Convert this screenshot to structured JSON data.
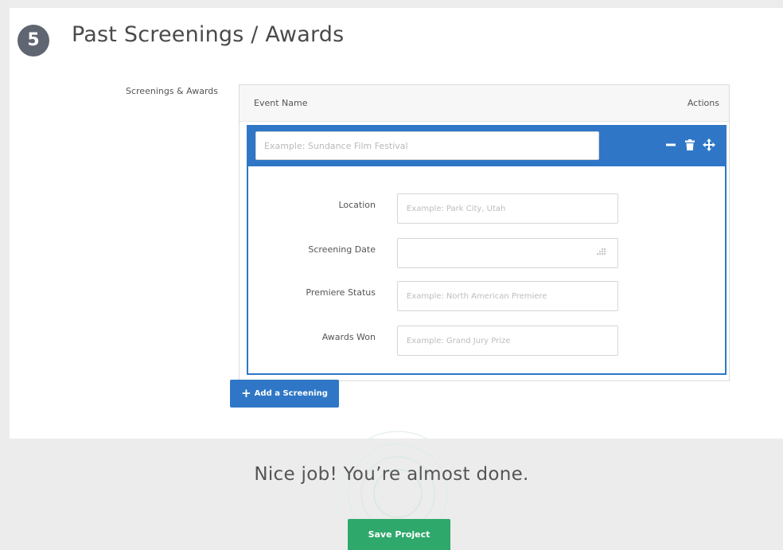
{
  "section": {
    "step_number": "5",
    "title": "Past Screenings / Awards",
    "field_label": "Screenings & Awards"
  },
  "table": {
    "col_event_name": "Event Name",
    "col_actions": "Actions"
  },
  "entry": {
    "event_placeholder": "Example: Sundance Film Festival",
    "actions": [
      "minus-icon",
      "trash-icon",
      "move-icon"
    ],
    "fields": [
      {
        "label": "Location",
        "placeholder": "Example: Park City, Utah",
        "value": ""
      },
      {
        "label": "Screening Date",
        "placeholder": "",
        "value": ""
      },
      {
        "label": "Premiere Status",
        "placeholder": "Example: North American Premiere",
        "value": ""
      },
      {
        "label": "Awards Won",
        "placeholder": "Example: Grand Jury Prize",
        "value": ""
      }
    ]
  },
  "add_button": {
    "icon": "+",
    "label": "Add a Screening"
  },
  "footer": {
    "message": "Nice job! You’re almost done.",
    "save_label": "Save Project"
  },
  "colors": {
    "primary_blue": "#2f77c6",
    "save_green": "#2ea86b",
    "step_circle": "#5f6672",
    "background": "#ececec"
  }
}
